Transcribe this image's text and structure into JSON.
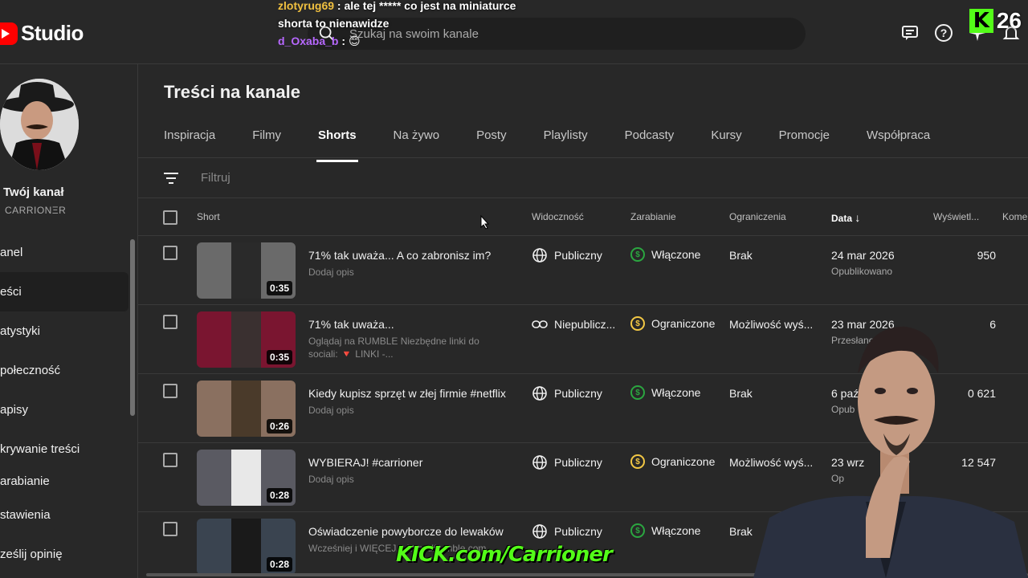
{
  "header": {
    "logo_text": "Studio",
    "search_placeholder": "Szukaj na swoim kanale"
  },
  "chat": {
    "line1_user": "zlotyrug69",
    "line1_msg": ": ale tej ***** co jest na miniaturce",
    "line2_msg": "shorta to nienawidze",
    "line3_user": "d_Oxaba_b",
    "line3_msg": ":"
  },
  "kick": {
    "badge_letter": "K",
    "viewer_count": "26",
    "url": "KICK.com/Carrioner"
  },
  "sidebar": {
    "channel_label": "Twój kanał",
    "channel_name": "CARRIONΞR",
    "items": [
      {
        "label": "anel"
      },
      {
        "label": "eści"
      },
      {
        "label": "atystyki"
      },
      {
        "label": "połeczność"
      },
      {
        "label": "apisy"
      },
      {
        "label": "krywanie treści"
      },
      {
        "label": "arabianie"
      }
    ],
    "bottom_items": [
      {
        "label": "stawienia"
      },
      {
        "label": "ześlij opinię"
      }
    ]
  },
  "main": {
    "title": "Treści na kanale",
    "tabs": [
      {
        "label": "Inspiracja"
      },
      {
        "label": "Filmy"
      },
      {
        "label": "Shorts"
      },
      {
        "label": "Na żywo"
      },
      {
        "label": "Posty"
      },
      {
        "label": "Playlisty"
      },
      {
        "label": "Podcasty"
      },
      {
        "label": "Kursy"
      },
      {
        "label": "Promocje"
      },
      {
        "label": "Współpraca"
      }
    ],
    "active_tab": "Shorts",
    "filter_placeholder": "Filtruj"
  },
  "table": {
    "headers": {
      "short": "Short",
      "visibility": "Widoczność",
      "monetization": "Zarabianie",
      "restrictions": "Ograniczenia",
      "date": "Data",
      "views": "Wyświetl...",
      "comments": "Kome"
    },
    "rows": [
      {
        "title": "71% tak uważa... A co zabronisz im?",
        "desc": "Dodaj opis",
        "duration": "0:35",
        "visibility": "Publiczny",
        "monetization": "Włączone",
        "restrictions": "Brak",
        "date": "24 mar 2026",
        "date_sub": "Opublikowano",
        "views": "950"
      },
      {
        "title": "71% tak uważa...",
        "desc": "Oglądaj na RUMBLE Niezbędne linki do sociali: 🔻 LINKI -...",
        "duration": "0:35",
        "visibility": "Niepublicz...",
        "monetization": "Ograniczone",
        "restrictions": "Możliwość wyś...",
        "date": "23 mar 2026",
        "date_sub": "Przesłano",
        "views": "6"
      },
      {
        "title": "Kiedy kupisz sprzęt w złej firmie #netflix",
        "desc": "Dodaj opis",
        "duration": "0:26",
        "visibility": "Publiczny",
        "monetization": "Włączone",
        "restrictions": "Brak",
        "date": "6 paź",
        "date_sub": "Opub",
        "views": "0 621"
      },
      {
        "title": "WYBIERAJ! #carrioner",
        "desc": "Dodaj opis",
        "duration": "0:28",
        "visibility": "Publiczny",
        "monetization": "Ograniczone",
        "restrictions": "Możliwość wyś...",
        "date": "23 wrz",
        "date_sub": "Op",
        "views": "12 547"
      },
      {
        "title": "Oświadczenie powyborcze do lewaków",
        "desc": "Wcześniej i WIĘCEJ... https://rumble.com",
        "duration": "0:28",
        "visibility": "Publiczny",
        "monetization": "Włączone",
        "restrictions": "Brak",
        "date": "",
        "date_sub": "",
        "views": ""
      }
    ]
  },
  "colors": {
    "background": "#282828",
    "accent_green": "#2ba640",
    "accent_yellow": "#f2c744",
    "kick_green": "#53fc18",
    "youtube_red": "#ff0000"
  }
}
